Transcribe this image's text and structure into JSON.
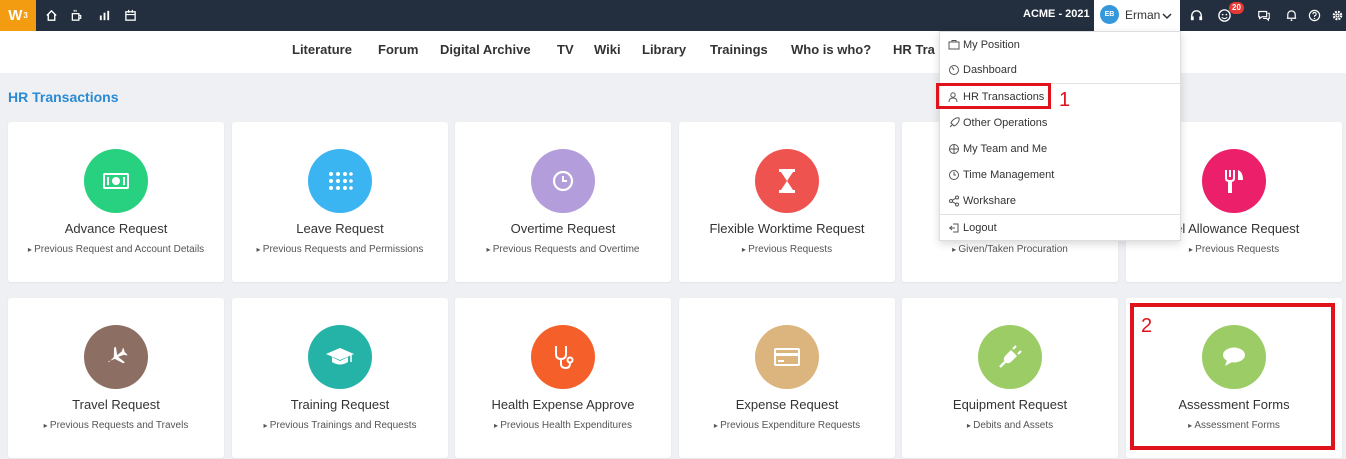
{
  "topbar": {
    "logo": "W",
    "logo_sup": "3",
    "icons": [
      "home-icon",
      "coffee-icon",
      "chart-icon",
      "calendar-icon"
    ],
    "company": "ACME - 2021",
    "user_initials": "EB",
    "user_name": "Erman",
    "right_icons": [
      "headset-icon",
      "smile-icon",
      "chat-icon",
      "bell-icon",
      "help-icon",
      "gear-icon"
    ],
    "notification_count": "20"
  },
  "nav": [
    "Literature",
    "Forum",
    "Digital Archive",
    "TV",
    "Wiki",
    "Library",
    "Trainings",
    "Who is who?",
    "HR Tra"
  ],
  "section_title": "HR Transactions",
  "cards_row1": [
    {
      "title": "Advance Request",
      "sub": "Previous Request and Account Details",
      "color": "#27d17f",
      "icon": "money-icon"
    },
    {
      "title": "Leave Request",
      "sub": "Previous Requests and Permissions",
      "color": "#3bb4f2",
      "icon": "grid-dots-icon"
    },
    {
      "title": "Overtime Request",
      "sub": "Previous Requests and Overtime",
      "color": "#b39ddb",
      "icon": "clock-icon"
    },
    {
      "title": "Flexible Worktime Request",
      "sub": "Previous Requests",
      "color": "#ef5350",
      "icon": "hourglass-icon"
    },
    {
      "title": "",
      "sub": "Given/Taken Procuration",
      "color": "#ffffff",
      "icon": ""
    },
    {
      "title": "vel Allowance Request",
      "sub": "Previous Requests",
      "color": "#ec1f6b",
      "icon": "cutlery-icon"
    }
  ],
  "cards_row2": [
    {
      "title": "Travel Request",
      "sub": "Previous Requests and Travels",
      "color": "#8d6e63",
      "icon": "plane-icon"
    },
    {
      "title": "Training Request",
      "sub": "Previous Trainings and Requests",
      "color": "#26b3a7",
      "icon": "graduation-cap-icon"
    },
    {
      "title": "Health Expense Approve",
      "sub": "Previous Health Expenditures",
      "color": "#f5602a",
      "icon": "stethoscope-icon"
    },
    {
      "title": "Expense Request",
      "sub": "Previous Expenditure Requests",
      "color": "#dcb47d",
      "icon": "credit-card-icon"
    },
    {
      "title": "Equipment Request",
      "sub": "Debits and Assets",
      "color": "#9ccc65",
      "icon": "plug-icon"
    },
    {
      "title": "Assessment Forms",
      "sub": "Assessment Forms",
      "color": "#9ccc65",
      "icon": "speech-bubble-icon"
    }
  ],
  "menu": [
    "My Position",
    "Dashboard",
    "HR Transactions",
    "Other Operations",
    "My Team and Me",
    "Time Management",
    "Workshare",
    "Logout"
  ],
  "annotations": [
    "1",
    "2"
  ]
}
